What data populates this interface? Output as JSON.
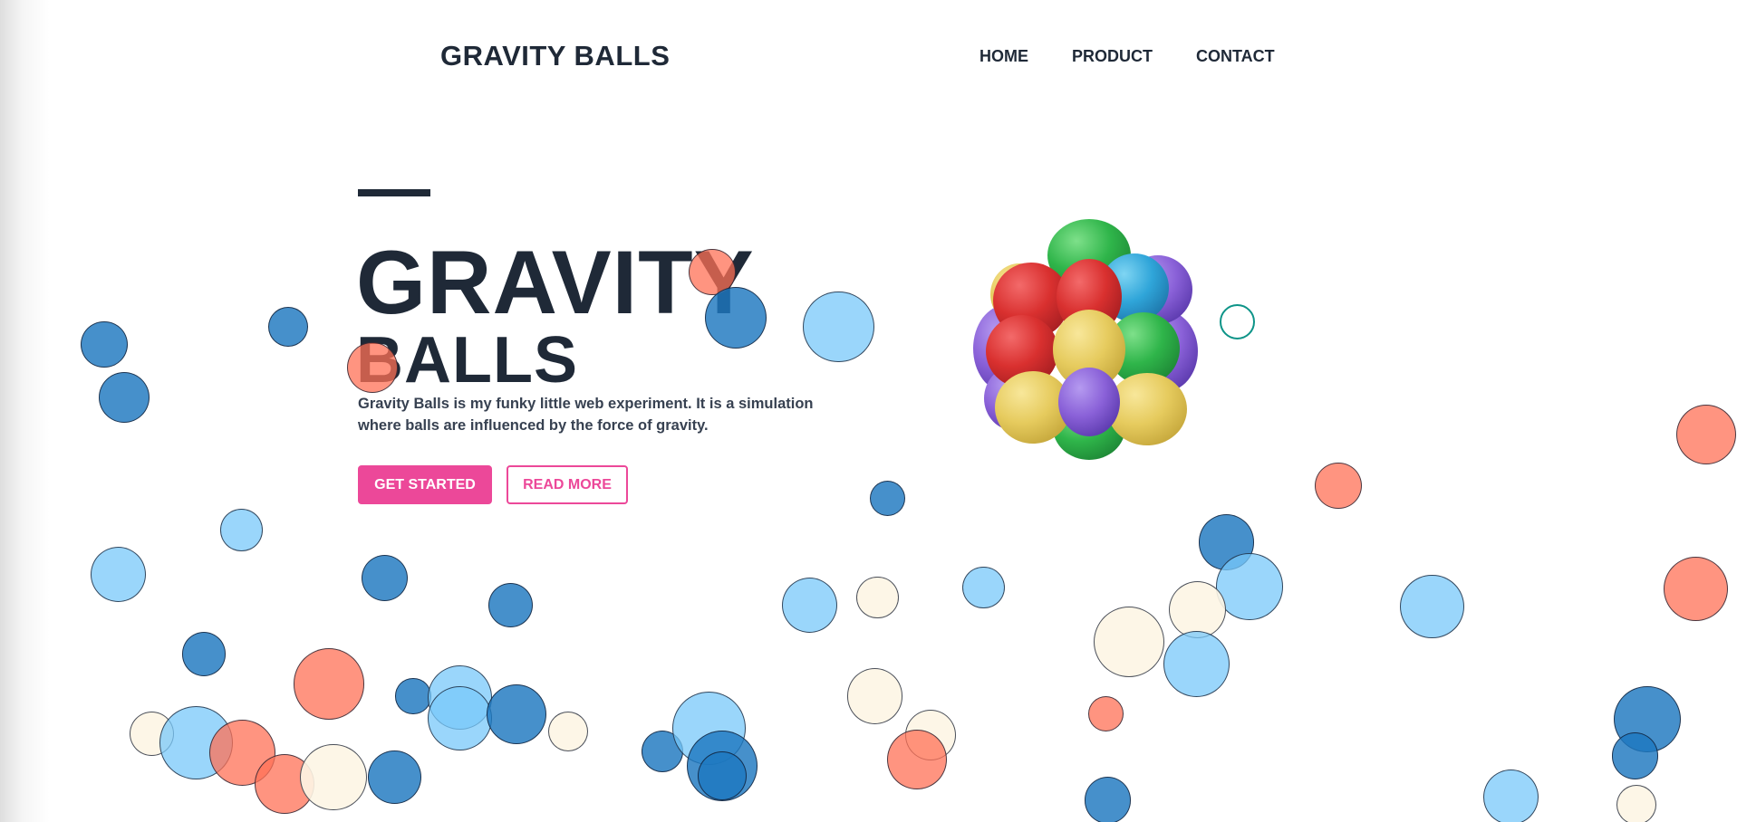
{
  "header": {
    "logo_text": "GRAVITY BALLS",
    "nav": [
      {
        "label": "HOME"
      },
      {
        "label": "PRODUCT"
      },
      {
        "label": "CONTACT"
      }
    ]
  },
  "hero": {
    "title_line1": "GRAVITY",
    "title_line2": "BALLS",
    "description": "Gravity Balls is my funky little web experiment. It is a simulation where balls are influenced by the force of gravity.",
    "primary_button": "GET STARTED",
    "secondary_button": "READ MORE"
  },
  "colors": {
    "text": "#1f2937",
    "accent": "#ec4899",
    "ball_dark_blue": "#1d78c0",
    "ball_light_blue": "#78c8fa",
    "ball_salmon": "#ff7055",
    "ball_cream": "#fdf5e4",
    "ring": "#0d9488"
  },
  "icons": {
    "hero_graphic": "colorful-ball-cluster-icon"
  }
}
